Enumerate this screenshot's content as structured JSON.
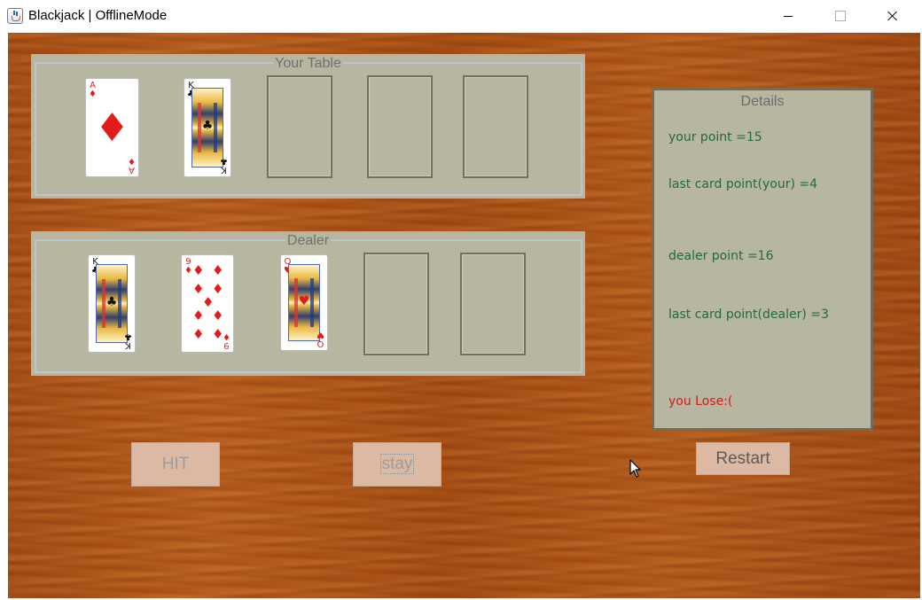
{
  "window": {
    "title": "Blackjack | OfflineMode",
    "app_icon": "java-coffee-icon",
    "controls": [
      "minimize-icon",
      "maximize-icon",
      "close-icon"
    ]
  },
  "your_table": {
    "title": "Your Table",
    "cards": [
      {
        "rank": "A",
        "suit": "♦",
        "color": "red"
      },
      {
        "rank": "K",
        "suit": "♣",
        "color": "black"
      }
    ],
    "empty_slots": 3
  },
  "dealer": {
    "title": "Dealer",
    "cards": [
      {
        "rank": "K",
        "suit": "♣",
        "color": "black"
      },
      {
        "rank": "9",
        "suit": "♦",
        "color": "red"
      },
      {
        "rank": "Q",
        "suit": "♥",
        "color": "red"
      }
    ],
    "empty_slots": 2
  },
  "details": {
    "title": "Details",
    "your_point": "your point =15",
    "last_card_your": "last card point(your) =4",
    "dealer_point": "dealer point =16",
    "last_card_dealer": "last card point(dealer) =3",
    "result": "you Lose:("
  },
  "buttons": {
    "hit": "HIT",
    "stay": "stay",
    "restart": "Restart"
  },
  "colors": {
    "panel_bg": "#b7b6a1",
    "button_bg": "#dcb9a2",
    "detail_text": "#1f6b3a",
    "lose_text": "#d21b1b"
  }
}
